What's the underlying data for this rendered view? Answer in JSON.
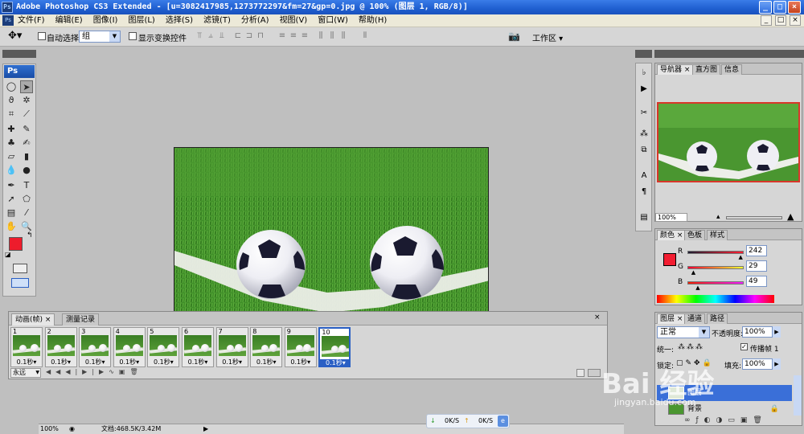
{
  "window": {
    "title": "Adobe Photoshop CS3 Extended - [u=3082417985,1273772297&fm=27&gp=0.jpg @ 100% (图层 1, RGB/8)]",
    "controls": [
      "_",
      "□",
      "×"
    ]
  },
  "menubar": {
    "items": [
      "文件(F)",
      "编辑(E)",
      "图像(I)",
      "图层(L)",
      "选择(S)",
      "滤镜(T)",
      "分析(A)",
      "视图(V)",
      "窗口(W)",
      "帮助(H)"
    ],
    "doc_controls": [
      "_",
      "□",
      "×"
    ]
  },
  "options": {
    "auto_select_label": "自动选择:",
    "auto_select_value": "组",
    "show_transform_label": "显示变换控件",
    "workspace_label": "工作区 ▾"
  },
  "tools": {
    "logo": "Ps",
    "foreground_color": "#ee1c2c",
    "background_color": "#ffffff"
  },
  "animation": {
    "tabs": [
      "动画(帧)",
      "测量记录"
    ],
    "frames": [
      {
        "n": "1",
        "delay": "0.1秒"
      },
      {
        "n": "2",
        "delay": "0.1秒"
      },
      {
        "n": "3",
        "delay": "0.1秒"
      },
      {
        "n": "4",
        "delay": "0.1秒"
      },
      {
        "n": "5",
        "delay": "0.1秒"
      },
      {
        "n": "6",
        "delay": "0.1秒"
      },
      {
        "n": "7",
        "delay": "0.1秒"
      },
      {
        "n": "8",
        "delay": "0.1秒"
      },
      {
        "n": "9",
        "delay": "0.1秒"
      },
      {
        "n": "10",
        "delay": "0.1秒"
      }
    ],
    "selected_frame": 10,
    "loop_value": "永远"
  },
  "navigator": {
    "tabs": [
      "导航器",
      "直方图",
      "信息"
    ],
    "zoom": "100%"
  },
  "color_panel": {
    "tabs": [
      "颜色",
      "色板",
      "样式"
    ],
    "r_label": "R",
    "g_label": "G",
    "b_label": "B",
    "r": "242",
    "g": "29",
    "b": "49",
    "r_frac": 0.95,
    "g_frac": 0.11,
    "b_frac": 0.19,
    "swatch": "#f21d31"
  },
  "layers_panel": {
    "tabs": [
      "图层",
      "通道",
      "路径"
    ],
    "blend_mode": "正常",
    "opacity_label": "不透明度:",
    "opacity": "100%",
    "unify_label": "统一:",
    "propagate_label": "传播帧 1",
    "lock_label": "锁定:",
    "fill_label": "填充:",
    "fill": "100%",
    "layer_selected": "图层",
    "layer_bg": "背景"
  },
  "status": {
    "zoom": "100%",
    "doc_label": "文档:468.5K/3.42M"
  },
  "download": {
    "down": "0K/S",
    "up": "0K/S"
  },
  "watermark": {
    "main": "Bai 经验",
    "sub": "jingyan.baidu.com"
  }
}
